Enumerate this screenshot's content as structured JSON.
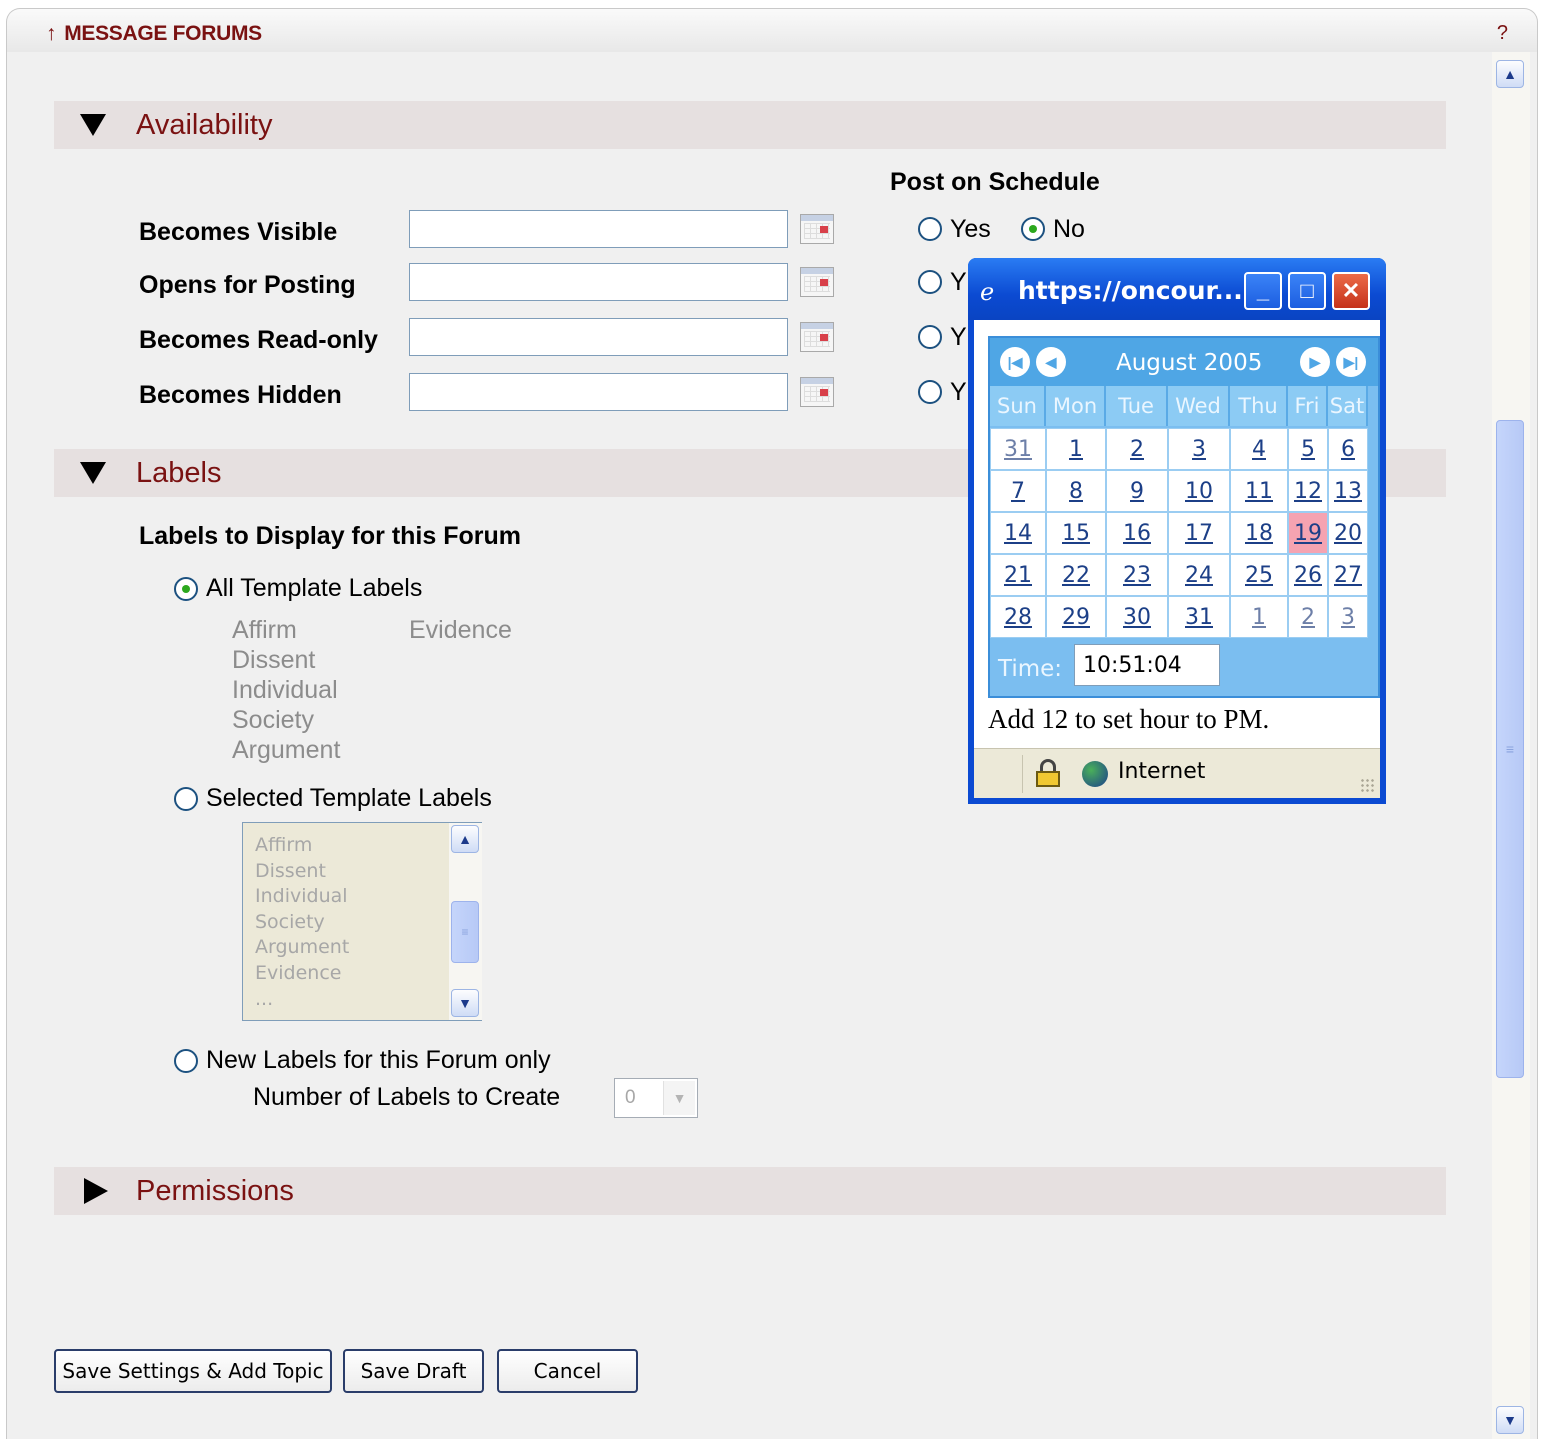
{
  "tool": {
    "title": "MESSAGE FORUMS",
    "help": "?"
  },
  "availability": {
    "section_title": "Availability",
    "post_on_schedule": "Post on Schedule",
    "fields": [
      {
        "label": "Becomes Visible",
        "value": ""
      },
      {
        "label": "Opens for Posting",
        "value": ""
      },
      {
        "label": "Becomes Read-only",
        "value": ""
      },
      {
        "label": "Becomes Hidden",
        "value": ""
      }
    ],
    "yes": "Yes",
    "no": "No",
    "y_partial": "Y"
  },
  "labels": {
    "section_title": "Labels",
    "heading": "Labels to Display for this Forum",
    "opt_all": "All Template Labels",
    "all_col1": [
      "Affirm",
      "Dissent",
      "Individual",
      "Society",
      "Argument"
    ],
    "all_col2": [
      "Evidence"
    ],
    "opt_selected": "Selected Template Labels",
    "listbox_items": [
      "Affirm",
      "Dissent",
      "Individual",
      "Society",
      "Argument",
      "Evidence",
      "..."
    ],
    "opt_new": "New Labels for this Forum only",
    "num_to_create": "Number of Labels to Create",
    "num_value": "0"
  },
  "permissions": {
    "section_title": "Permissions"
  },
  "buttons": {
    "save_add": "Save Settings & Add Topic",
    "save_draft": "Save Draft",
    "cancel": "Cancel"
  },
  "popup": {
    "title": "https://oncour...",
    "month": "August 2005",
    "dow": [
      "Sun",
      "Mon",
      "Tue",
      "Wed",
      "Thu",
      "Fri",
      "Sat"
    ],
    "weeks": [
      [
        "31",
        "1",
        "2",
        "3",
        "4",
        "5",
        "6"
      ],
      [
        "7",
        "8",
        "9",
        "10",
        "11",
        "12",
        "13"
      ],
      [
        "14",
        "15",
        "16",
        "17",
        "18",
        "19",
        "20"
      ],
      [
        "21",
        "22",
        "23",
        "24",
        "25",
        "26",
        "27"
      ],
      [
        "28",
        "29",
        "30",
        "31",
        "1",
        "2",
        "3"
      ]
    ],
    "time_label": "Time:",
    "time_value": "10:51:04",
    "note": "Add 12 to set hour to PM.",
    "status_zone": "Internet"
  }
}
